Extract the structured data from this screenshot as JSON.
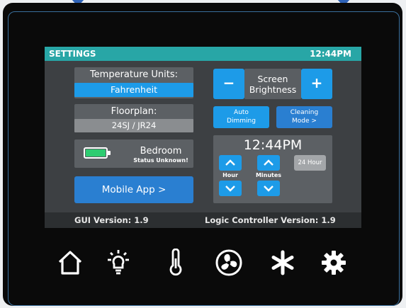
{
  "header": {
    "title": "SETTINGS",
    "time": "12:44PM"
  },
  "temperature": {
    "label": "Temperature Units:",
    "value": "Fahrenheit"
  },
  "floorplan": {
    "label": "Floorplan:",
    "value": "24SJ / JR24"
  },
  "battery": {
    "room": "Bedroom",
    "status": "Status Unknown!"
  },
  "mobile_app": {
    "label": "Mobile App >"
  },
  "brightness": {
    "minus": "−",
    "label_line1": "Screen",
    "label_line2": "Brightness",
    "plus": "+"
  },
  "auto_dimming": {
    "line1": "Auto",
    "line2": "Dimming"
  },
  "cleaning_mode": {
    "line1": "Cleaning",
    "line2": "Mode >"
  },
  "clock": {
    "time": "12:44PM",
    "hour_label": "Hour",
    "minutes_label": "Minutes",
    "format_button": "24 Hour"
  },
  "footer": {
    "gui_version": "GUI Version: 1.9",
    "logic_version": "Logic Controller Version: 1.9"
  },
  "nav_icons": [
    "home-icon",
    "light-bulb-icon",
    "thermometer-icon",
    "fan-icon",
    "snowflake-icon",
    "gear-icon"
  ],
  "colors": {
    "header": "#28a6a6",
    "accent_blue": "#1d9be8",
    "panel": "#3d4043",
    "battery_green": "#2ecc71",
    "bezel_edge": "#3a6f9c"
  }
}
